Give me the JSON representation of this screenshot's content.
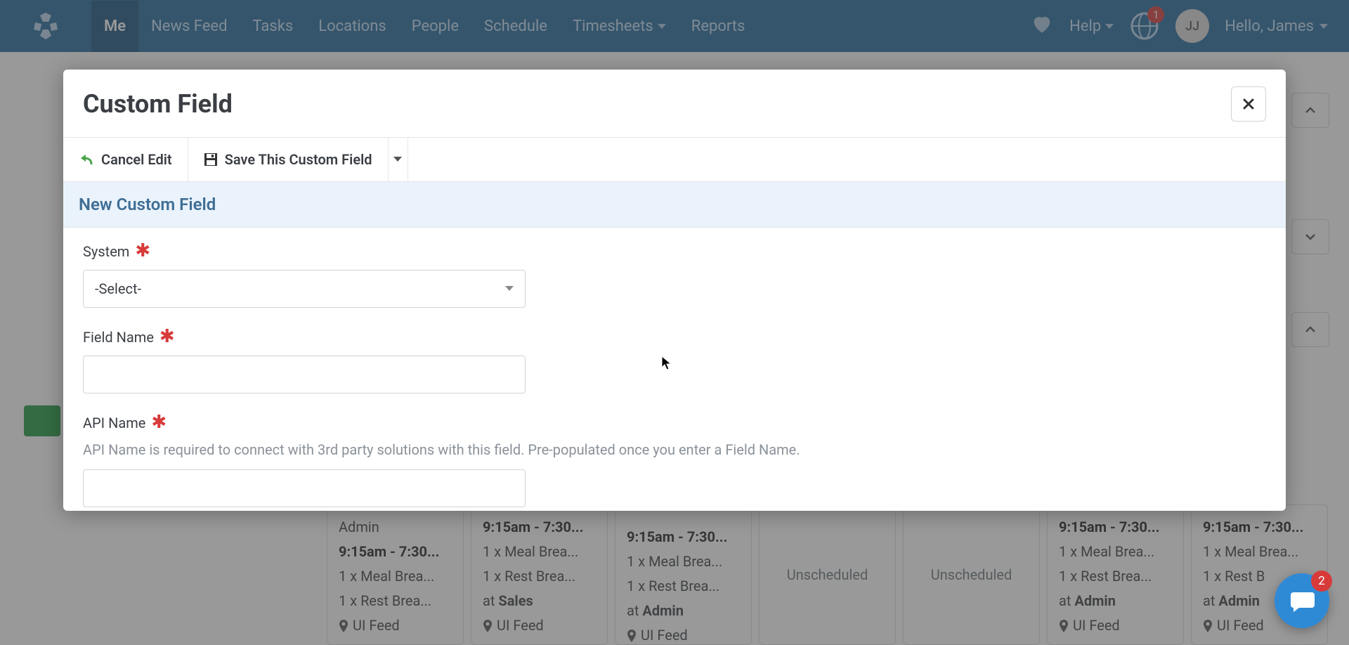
{
  "nav": {
    "items": [
      "Me",
      "News Feed",
      "Tasks",
      "Locations",
      "People",
      "Schedule",
      "Timesheets",
      "Reports"
    ],
    "active_index": 0,
    "help_label": "Help",
    "notif_count": "1",
    "avatar_initials": "JJ",
    "hello_text": "Hello, James"
  },
  "modal": {
    "title": "Custom Field",
    "toolbar": {
      "cancel_label": "Cancel Edit",
      "save_label": "Save This Custom Field"
    },
    "section_title": "New Custom Field",
    "fields": {
      "system": {
        "label": "System",
        "value": "-Select-"
      },
      "field_name": {
        "label": "Field Name",
        "value": ""
      },
      "api_name": {
        "label": "API Name",
        "helper": "API Name is required to connect with 3rd party solutions with this field. Pre-populated once you enter a Field Name.",
        "value": ""
      }
    }
  },
  "bg": {
    "cards": [
      {
        "top": "Admin",
        "time": "9:15am - 7:30...",
        "l1": "1 x Meal Brea...",
        "l2": "1 x Rest Brea...",
        "loc_label": "UI Feed"
      },
      {
        "time": "9:15am - 7:30...",
        "l1": "1 x Meal Brea...",
        "l2": "1 x Rest Brea...",
        "at": "at ",
        "atv": "Sales",
        "loc_label": "UI Feed"
      },
      {
        "time": "9:15am - 7:30...",
        "l1": "1 x Meal Brea...",
        "l2": "1 x Rest Brea...",
        "at": "at ",
        "atv": "Admin",
        "loc_label": "UI Feed"
      },
      {
        "text": "Unscheduled"
      },
      {
        "text": "Unscheduled"
      },
      {
        "time": "9:15am - 7:30...",
        "l1": "1 x Meal Brea...",
        "l2": "1 x Rest Brea...",
        "at": "at ",
        "atv": "Admin",
        "loc_label": "UI Feed"
      },
      {
        "time": "9:15am - 7:30...",
        "l1": "1 x Meal Brea...",
        "l2": "1 x Rest B",
        "at": "at ",
        "atv": "Admin",
        "loc_label": "UI Feed"
      }
    ]
  },
  "chat": {
    "count": "2"
  }
}
